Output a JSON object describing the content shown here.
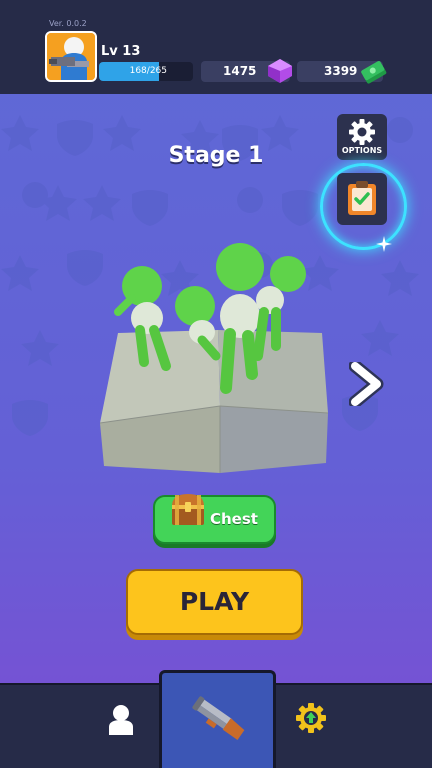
{
  "header": {
    "version": "Ver. 0.0.2",
    "level": "Lv 13",
    "xp": "168/265",
    "xp_progress": 0.634,
    "gems": "1475",
    "cash": "3399"
  },
  "stage": {
    "title": "Stage 1"
  },
  "options": {
    "label": "OPTIONS"
  },
  "buttons": {
    "chest": "Chest",
    "play": "PLAY"
  },
  "nav": {
    "tabs": [
      {
        "icon": "character-icon",
        "active": false
      },
      {
        "icon": "shotgun-icon",
        "active": true
      },
      {
        "icon": "upgrade-gear-icon",
        "active": false
      }
    ]
  },
  "colors": {
    "background_top": "#5d68d4",
    "background_bottom": "#7a4fd3",
    "bar": "#262b48",
    "play": "#fdc41c",
    "chest": "#43d458",
    "quest_glow": "#3de2ff"
  }
}
